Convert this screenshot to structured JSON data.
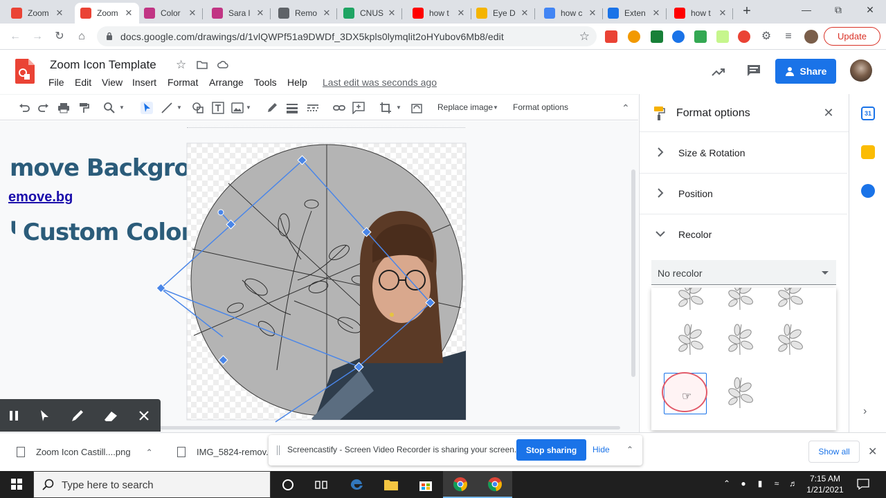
{
  "browser": {
    "tabs": [
      {
        "title": "Zoom",
        "icon": "google-slides-icon",
        "color": "#ea4335"
      },
      {
        "title": "Zoom",
        "icon": "google-drawings-icon",
        "color": "#ea4335",
        "active": true
      },
      {
        "title": "Color",
        "icon": "instagram-icon",
        "color": "#c13584"
      },
      {
        "title": "Sara l",
        "icon": "instagram-icon",
        "color": "#c13584"
      },
      {
        "title": "Remo",
        "icon": "remove-bg-icon",
        "color": "#5f6368"
      },
      {
        "title": "CNUS",
        "icon": "google-drive-icon",
        "color": "#1fa463"
      },
      {
        "title": "how t",
        "icon": "youtube-icon",
        "color": "#ff0000"
      },
      {
        "title": "Eye D",
        "icon": "rainbow-icon",
        "color": "#f4b400"
      },
      {
        "title": "how c",
        "icon": "google-icon",
        "color": "#4285f4"
      },
      {
        "title": "Exten",
        "icon": "puzzle-icon",
        "color": "#1a73e8"
      },
      {
        "title": "how t",
        "icon": "youtube-icon",
        "color": "#ff0000"
      }
    ],
    "url": "docs.google.com/drawings/d/1vlQWPf51a9DWDf_3DX5kpls0lymqlit2oHYubov6Mb8/edit",
    "update_label": "Update"
  },
  "doc": {
    "title": "Zoom Icon Template",
    "menus": [
      "File",
      "Edit",
      "View",
      "Insert",
      "Format",
      "Arrange",
      "Tools",
      "Help"
    ],
    "last_edit": "Last edit was seconds ago",
    "share_label": "Share"
  },
  "toolbar": {
    "replace_image": "Replace image",
    "format_options": "Format options"
  },
  "canvas": {
    "line1": "move Background",
    "link": "emove.bg",
    "line3": "Custom Color"
  },
  "panel": {
    "title": "Format options",
    "sections": [
      "Size & Rotation",
      "Position",
      "Recolor"
    ],
    "recolor_value": "No recolor"
  },
  "screencastify": {
    "message": "Screencastify - Screen Video Recorder is sharing your screen.",
    "stop_label": "Stop sharing",
    "hide_label": "Hide"
  },
  "downloads": {
    "items": [
      "Zoom Icon Castill....png",
      "IMG_5824-remov..."
    ],
    "show_all": "Show all"
  },
  "taskbar": {
    "search_placeholder": "Type here to search",
    "time": "7:15 AM",
    "date": "1/21/2021"
  },
  "colors": {
    "accent": "#1a73e8",
    "title_text": "#2b5c7a",
    "update_red": "#d93025",
    "circle_gray": "#b4b4b4",
    "selection_blue": "#4a86e8"
  }
}
